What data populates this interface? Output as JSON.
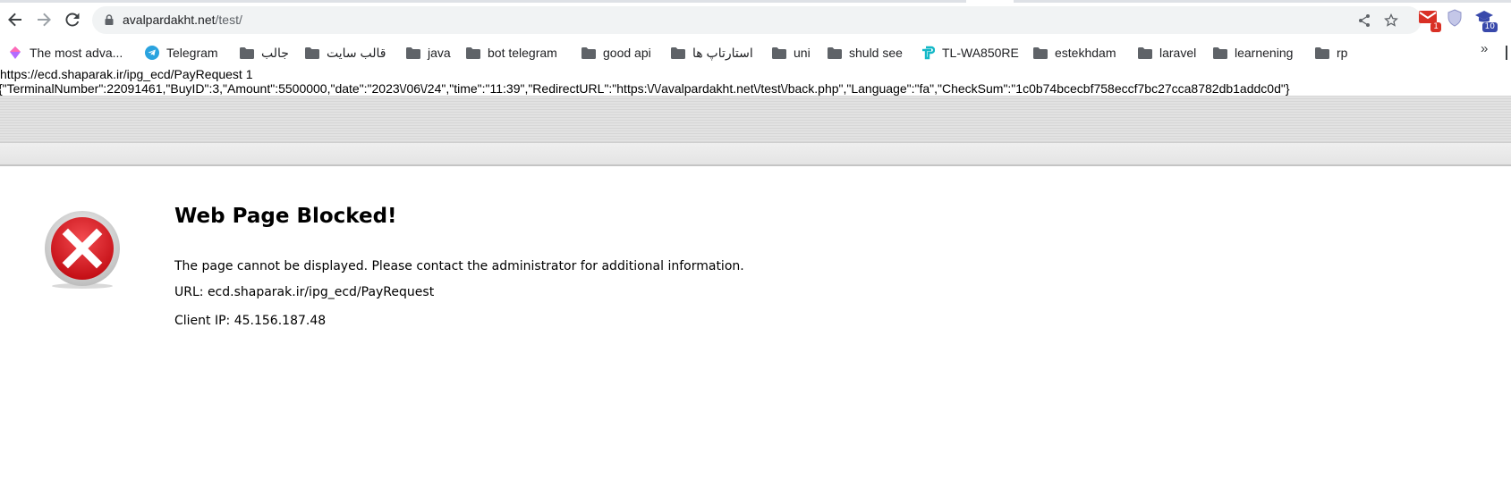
{
  "browser": {
    "url_host": "avalpardakht.net",
    "url_path": "/test/",
    "extensions": [
      {
        "name": "gmail",
        "badge": "1"
      },
      {
        "name": "shield",
        "badge": ""
      },
      {
        "name": "graduation",
        "badge": "10"
      }
    ]
  },
  "bookmarks": [
    {
      "label": "The most adva...",
      "icon": "diamond-icon"
    },
    {
      "label": "Telegram",
      "icon": "telegram-icon"
    },
    {
      "label": "جالب",
      "icon": "folder-icon"
    },
    {
      "label": "قالب سایت",
      "icon": "folder-icon"
    },
    {
      "label": "java",
      "icon": "folder-icon"
    },
    {
      "label": "bot telegram",
      "icon": "folder-icon"
    },
    {
      "label": "good api",
      "icon": "folder-icon"
    },
    {
      "label": "استارتاپ ها",
      "icon": "folder-icon"
    },
    {
      "label": "uni",
      "icon": "folder-icon"
    },
    {
      "label": "shuld see",
      "icon": "folder-icon"
    },
    {
      "label": "TL-WA850RE",
      "icon": "tplink-icon"
    },
    {
      "label": "estekhdam",
      "icon": "folder-icon"
    },
    {
      "label": "laravel",
      "icon": "folder-icon"
    },
    {
      "label": "learnening",
      "icon": "folder-icon"
    },
    {
      "label": "rp",
      "icon": "folder-icon"
    }
  ],
  "bookmarks_more": "»",
  "echo": {
    "line1": "https://ecd.shaparak.ir/ipg_ecd/PayRequest 1",
    "line2": "{\"TerminalNumber\":22091461,\"BuyID\":3,\"Amount\":5500000,\"date\":\"2023\\/06\\/24\",\"time\":\"11:39\",\"RedirectURL\":\"https:\\/\\/avalpardakht.net\\/test\\/back.php\",\"Language\":\"fa\",\"CheckSum\":\"1c0b74bcecbf758eccf7bc27cca8782db1addc0d\"}"
  },
  "blocked": {
    "title": "Web Page Blocked!",
    "message": "The page cannot be displayed. Please contact the administrator for additional information.",
    "url_line": "URL: ecd.shaparak.ir/ipg_ecd/PayRequest",
    "ip_line": "Client IP: 45.156.187.48"
  },
  "colors": {
    "error_red": "#d9141b",
    "band_grey": "#dcdcdc",
    "omnibox_bg": "#f1f3f4"
  }
}
